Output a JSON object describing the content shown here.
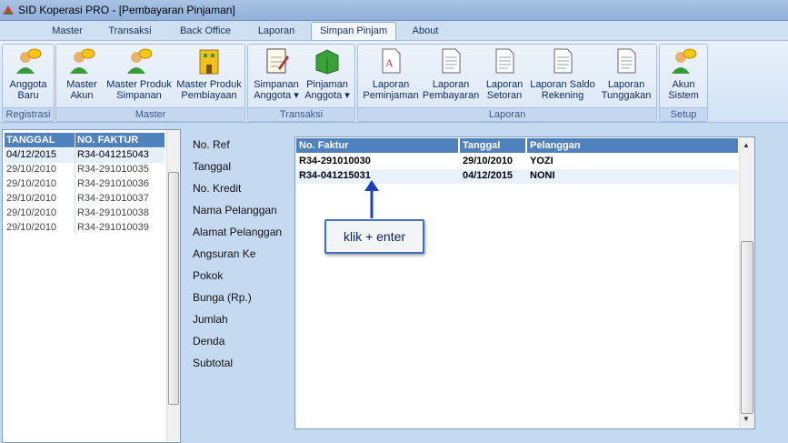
{
  "window": {
    "title": "SID Koperasi PRO - [Pembayaran Pinjaman]"
  },
  "menu": {
    "tabs": [
      "Master",
      "Transaksi",
      "Back Office",
      "Laporan",
      "Simpan Pinjam",
      "About"
    ],
    "active": "Simpan Pinjam"
  },
  "ribbon": {
    "groups": [
      {
        "label": "Registrasi",
        "buttons": [
          {
            "label": "Anggota\nBaru",
            "icon": "user-add-icon"
          }
        ]
      },
      {
        "label": "Master",
        "buttons": [
          {
            "label": "Master\nAkun",
            "icon": "user-icon"
          },
          {
            "label": "Master Produk\nSimpanan",
            "icon": "user-icon"
          },
          {
            "label": "Master Produk\nPembiayaan",
            "icon": "building-icon"
          }
        ]
      },
      {
        "label": "Transaksi",
        "buttons": [
          {
            "label": "Simpanan\nAnggota",
            "icon": "notepad-icon",
            "dropdown": true
          },
          {
            "label": "Pinjaman\nAnggota",
            "icon": "cash-box-icon",
            "dropdown": true
          }
        ]
      },
      {
        "label": "Laporan",
        "buttons": [
          {
            "label": "Laporan\nPeminjaman",
            "icon": "pdf-document-icon"
          },
          {
            "label": "Laporan\nPembayaran",
            "icon": "document-icon"
          },
          {
            "label": "Laporan\nSetoran",
            "icon": "document-icon"
          },
          {
            "label": "Laporan Saldo\nRekening",
            "icon": "document-icon"
          },
          {
            "label": "Laporan\nTunggakan",
            "icon": "document-icon"
          }
        ]
      },
      {
        "label": "Setup",
        "buttons": [
          {
            "label": "Akun\nSistem",
            "icon": "user-icon"
          }
        ]
      }
    ]
  },
  "left_list": {
    "headers": [
      "TANGGAL",
      "NO. FAKTUR"
    ],
    "rows": [
      [
        "04/12/2015",
        "R34-041215043"
      ],
      [
        "29/10/2010",
        "R34-291010035"
      ],
      [
        "29/10/2010",
        "R34-291010036"
      ],
      [
        "29/10/2010",
        "R34-291010037"
      ],
      [
        "29/10/2010",
        "R34-291010038"
      ],
      [
        "29/10/2010",
        "R34-291010039"
      ]
    ]
  },
  "form": {
    "labels": [
      "No. Ref",
      "Tanggal",
      "No. Kredit",
      "Nama Pelanggan",
      "Alamat Pelanggan",
      "Angsuran Ke",
      "Pokok",
      "Bunga (Rp.)",
      "Jumlah",
      "Denda",
      "Subtotal"
    ]
  },
  "lookup_grid": {
    "headers": [
      "No. Faktur",
      "Tanggal",
      "Pelanggan"
    ],
    "rows": [
      [
        "R34-291010030",
        "29/10/2010",
        "YOZI"
      ],
      [
        "R34-041215031",
        "04/12/2015",
        "NONI"
      ]
    ]
  },
  "annotation": {
    "text": "klik + enter"
  },
  "colors": {
    "header_blue": "#4f81bd",
    "callout_border": "#3f6fbf",
    "arrow": "#1f3fbf"
  }
}
